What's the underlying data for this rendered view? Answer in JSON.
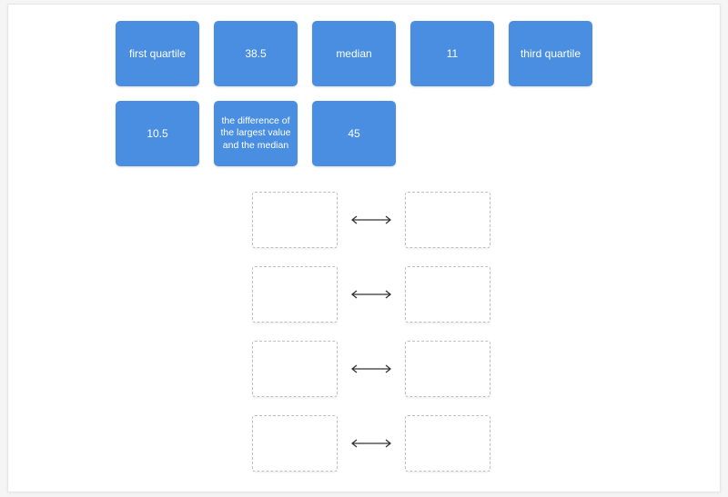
{
  "tiles": {
    "row1": [
      {
        "label": "first quartile",
        "name": "tile-first-quartile"
      },
      {
        "label": "38.5",
        "name": "tile-38-5"
      },
      {
        "label": "median",
        "name": "tile-median"
      },
      {
        "label": "11",
        "name": "tile-11"
      },
      {
        "label": "third quartile",
        "name": "tile-third-quartile"
      }
    ],
    "row2": [
      {
        "label": "10.5",
        "name": "tile-10-5"
      },
      {
        "label": "the difference of the largest value and the median",
        "name": "tile-difference-largest-median",
        "small": true
      },
      {
        "label": "45",
        "name": "tile-45"
      }
    ]
  },
  "match_rows": 4
}
